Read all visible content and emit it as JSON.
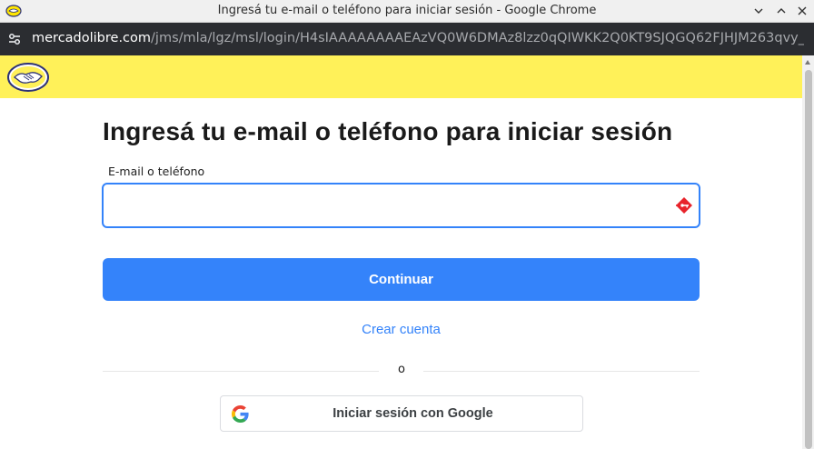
{
  "window": {
    "title": "Ingresá tu e-mail o teléfono para iniciar sesión - Google Chrome"
  },
  "addressbar": {
    "host": "mercadolibre.com",
    "path": "/jms/mla/lgz/msl/login/H4sIAAAAAAAAEAzVQ0W6DMAz8lzz0qQIWKK2Q0KT9SJQGQ62FJHJM263qvy_JxJt95_O..."
  },
  "page": {
    "heading": "Ingresá tu e-mail o teléfono para iniciar sesión",
    "email_label": "E-mail o teléfono",
    "email_value": "",
    "continue_label": "Continuar",
    "create_account_label": "Crear cuenta",
    "divider_text": "o",
    "google_button_label": "Iniciar sesión con Google"
  },
  "colors": {
    "brand_yellow": "#fff159",
    "accent_blue": "#3483fa",
    "chrome_dark": "#2b2d31"
  },
  "icons": {
    "app": "chrome-app-icon",
    "site_info": "site-info-icon",
    "logo": "mercadolibre-handshake-logo",
    "password_manager": "password-manager-icon",
    "google": "google-g-icon"
  }
}
